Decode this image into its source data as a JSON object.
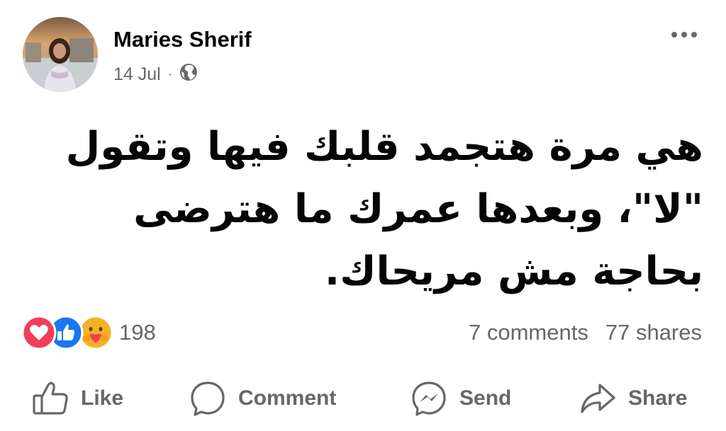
{
  "post": {
    "author": "Maries Sherif",
    "date": "14 Jul",
    "separator": "·",
    "visibility_icon": "globe-icon",
    "more_icon": "more-options-icon",
    "text": "هي مرة هتجمد قلبك فيها وتقول \"لا\"، وبعدها عمرك ما هترضى بحاجة مش مريحاك."
  },
  "reactions": {
    "icons": [
      "love-icon",
      "like-icon",
      "care-icon"
    ],
    "count": "198"
  },
  "stats": {
    "comments": "7 comments",
    "shares": "77 shares"
  },
  "actions": {
    "like": "Like",
    "comment": "Comment",
    "send": "Send",
    "share": "Share"
  },
  "colors": {
    "text_primary": "#050505",
    "text_secondary": "#65676b",
    "like_blue": "#1877f2",
    "love_red": "#f33e58",
    "care_yellow": "#f7b125"
  }
}
